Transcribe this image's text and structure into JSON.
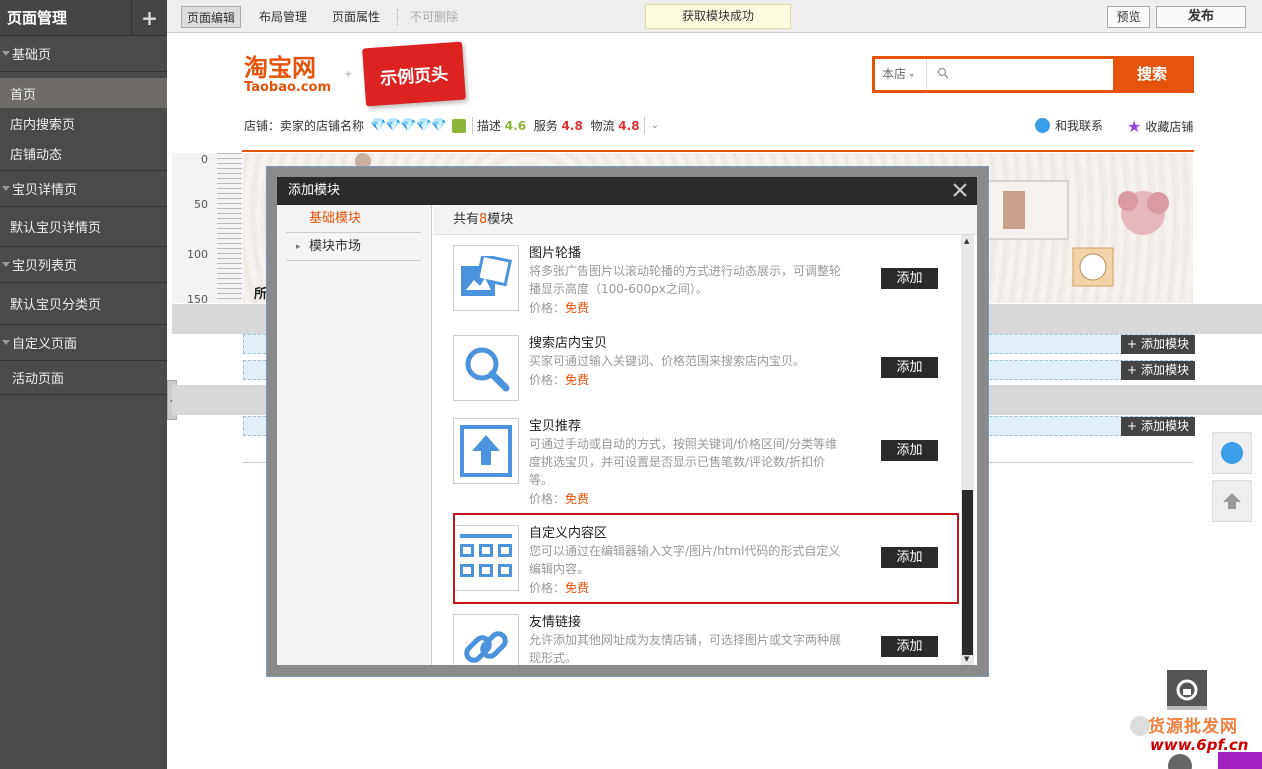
{
  "sidebar": {
    "title": "页面管理",
    "add": "+",
    "groups": [
      {
        "label": "基础页"
      },
      {
        "label": "宝贝详情页"
      },
      {
        "label": "宝贝列表页"
      },
      {
        "label": "自定义页面"
      }
    ],
    "items": [
      {
        "label": "首页"
      },
      {
        "label": "店内搜索页"
      },
      {
        "label": "店铺动态"
      },
      {
        "label": "默认宝贝详情页"
      },
      {
        "label": "默认宝贝分类页"
      },
      {
        "label": "活动页面"
      }
    ]
  },
  "toolbar": {
    "tabs": [
      "页面编辑",
      "布局管理",
      "页面属性",
      "不可删除"
    ],
    "toast": "获取模块成功",
    "preview": "预览",
    "publish": "发布"
  },
  "store": {
    "logo_cn": "淘宝网",
    "logo_en": "Taobao.com",
    "banner_tag": "示例页头",
    "search_scope": "本店",
    "search_button": "搜索",
    "shop_label": "店铺：卖家的店铺名称",
    "diamonds": "💎💎💎💎💎",
    "ratings": [
      {
        "label": "描述",
        "value": "4.6"
      },
      {
        "label": "服务",
        "value": "4.8"
      },
      {
        "label": "物流",
        "value": "4.8"
      }
    ],
    "contact": "和我联系",
    "favorite": "收藏店铺",
    "all_text": "所有"
  },
  "ruler": [
    "0",
    "50",
    "100",
    "150"
  ],
  "add_module_label": "添加模块",
  "modal": {
    "title": "添加模块",
    "categories": [
      "基础模块",
      "模块市场"
    ],
    "count_prefix": "共有",
    "count": "8",
    "count_suffix": "模块",
    "price_label": "价格：",
    "price_value": "免费",
    "add_label": "添加",
    "modules": [
      {
        "title": "图片轮播",
        "desc": "将多张广告图片以滚动轮播的方式进行动态展示，可调整轮播显示高度（100-600px之间）。",
        "icon": "picture-carousel-icon"
      },
      {
        "title": "搜索店内宝贝",
        "desc": "买家可通过输入关键词、价格范围来搜索店内宝贝。",
        "icon": "magnifier-icon"
      },
      {
        "title": "宝贝推荐",
        "desc": "可通过手动或自动的方式，按照关键词/价格区间/分类等维度挑选宝贝，并可设置是否显示已售笔数/评论数/折扣价等。",
        "icon": "up-arrow-icon"
      },
      {
        "title": "自定义内容区",
        "desc": "您可以通过在编辑器输入文字/图片/html代码的形式自定义编辑内容。",
        "icon": "grid-icon"
      },
      {
        "title": "友情链接",
        "desc": "允许添加其他网址成为友情店铺，可选择图片或文字两种展现形式。",
        "icon": "link-icon"
      }
    ]
  },
  "watermark": {
    "line1": "货源批发网",
    "line2": "www.6pf.cn"
  },
  "colors": {
    "brand": "#e4540b",
    "sidebar": "#4a4a4a",
    "highlight": "#c8161d"
  }
}
